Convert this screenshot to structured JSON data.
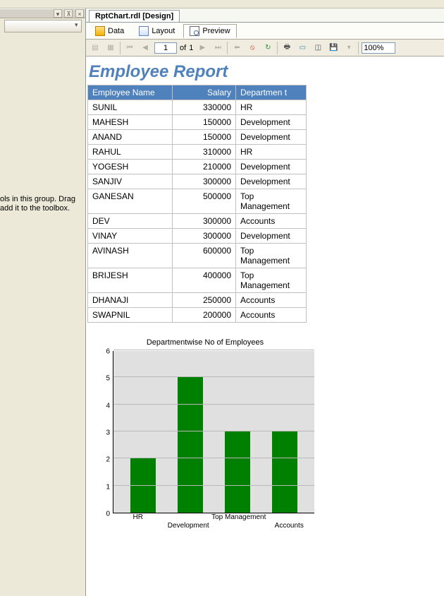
{
  "left_panel": {
    "hint": "ols in this group. Drag\nadd it to the toolbox."
  },
  "doc_tab": "RptChart.rdl [Design]",
  "view_tabs": {
    "data": "Data",
    "layout": "Layout",
    "preview": "Preview"
  },
  "toolbar": {
    "page_current": "1",
    "page_of": "of",
    "page_total": "1",
    "zoom": "100%"
  },
  "report": {
    "title": "Employee Report",
    "headers": {
      "name": "Employee Name",
      "salary": "Salary",
      "dept": "Departmen\nt"
    },
    "rows": [
      {
        "name": "SUNIL",
        "salary": "330000",
        "dept": "HR"
      },
      {
        "name": "MAHESH",
        "salary": "150000",
        "dept": "Development"
      },
      {
        "name": "ANAND",
        "salary": "150000",
        "dept": "Development"
      },
      {
        "name": "RAHUL",
        "salary": "310000",
        "dept": "HR"
      },
      {
        "name": "YOGESH",
        "salary": "210000",
        "dept": "Development"
      },
      {
        "name": "SANJIV",
        "salary": "300000",
        "dept": "Development"
      },
      {
        "name": "GANESAN",
        "salary": "500000",
        "dept": "Top Management"
      },
      {
        "name": "DEV",
        "salary": "300000",
        "dept": "Accounts"
      },
      {
        "name": "VINAY",
        "salary": "300000",
        "dept": "Development"
      },
      {
        "name": "AVINASH",
        "salary": "600000",
        "dept": "Top Management"
      },
      {
        "name": "BRIJESH",
        "salary": "400000",
        "dept": "Top Management"
      },
      {
        "name": "DHANAJI",
        "salary": "250000",
        "dept": "Accounts"
      },
      {
        "name": "SWAPNIL",
        "salary": "200000",
        "dept": "Accounts"
      }
    ]
  },
  "chart_data": {
    "type": "bar",
    "title": "Departmentwise No of Employees",
    "categories": [
      "HR",
      "Development",
      "Top Management",
      "Accounts"
    ],
    "values": [
      2,
      5,
      3,
      3
    ],
    "xlabel": "",
    "ylabel": "",
    "ylim": [
      0,
      6
    ],
    "yticks": [
      0,
      1,
      2,
      3,
      4,
      5,
      6
    ],
    "bar_color": "#008000",
    "plot_bg": "#e0e0e0"
  }
}
